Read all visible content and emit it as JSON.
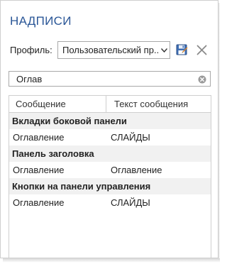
{
  "title": "НАДПИСИ",
  "profile": {
    "label": "Профиль:",
    "selected": "Пользовательский пр..."
  },
  "search": {
    "value": "Оглав"
  },
  "table": {
    "columns": [
      "Сообщение",
      "Текст сообщения"
    ],
    "groups": [
      {
        "name": "Вкладки боковой панели",
        "rows": [
          {
            "message": "Оглавление",
            "text": "СЛАЙДЫ"
          }
        ]
      },
      {
        "name": "Панель заголовка",
        "rows": [
          {
            "message": "Оглавление",
            "text": "Оглавление"
          }
        ]
      },
      {
        "name": "Кнопки на панели управления",
        "rows": [
          {
            "message": "Оглавление",
            "text": "СЛАЙДЫ"
          }
        ]
      }
    ]
  },
  "colors": {
    "title": "#2b5797",
    "group_bg": "#f1f1f1",
    "border": "#cfcfcf"
  }
}
